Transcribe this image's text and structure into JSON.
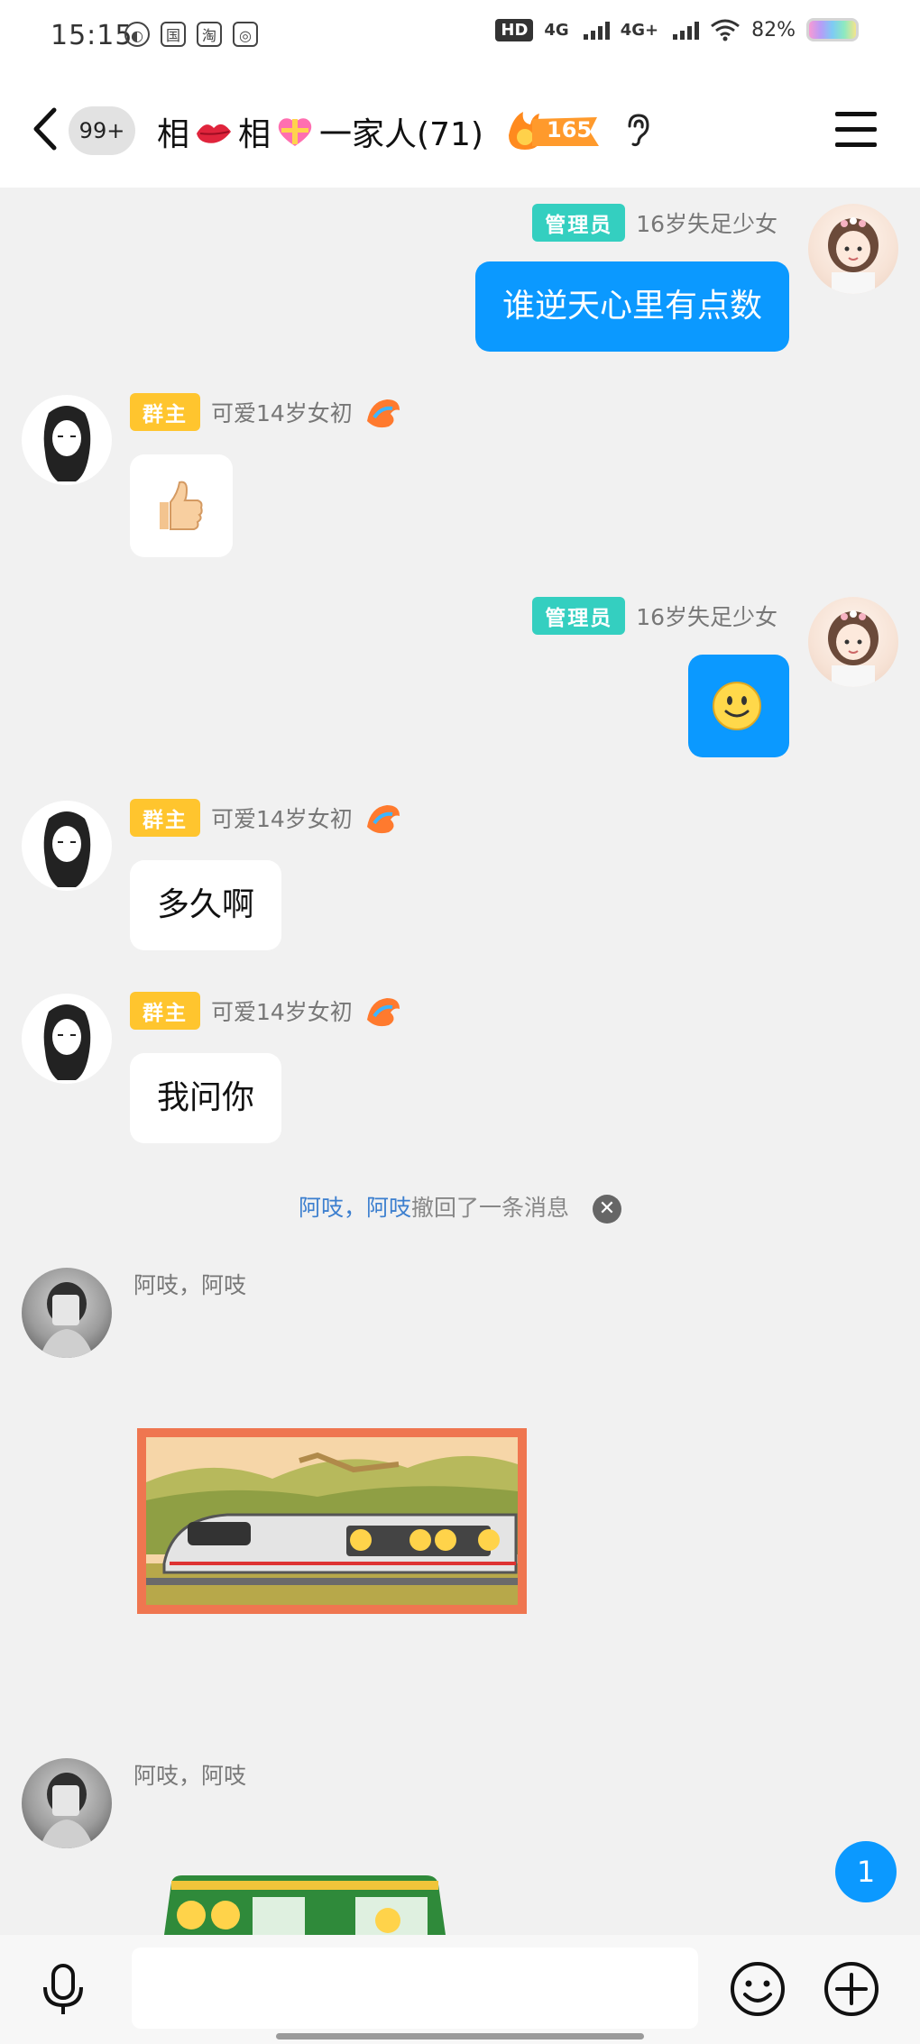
{
  "status_bar": {
    "time": "15:15",
    "app_icons": [
      "weibo-icon",
      "guo-icon",
      "taobao-icon",
      "app-icon"
    ],
    "hd": "HD",
    "net1": "4G",
    "net2": "4G+",
    "battery": "82%"
  },
  "header": {
    "unread_badge": "99+",
    "title_parts": [
      "相",
      "相",
      "一家人(71)"
    ],
    "fire_count": "165"
  },
  "messages": [
    {
      "side": "right",
      "tag": "管理员",
      "name": "16岁失足少女",
      "text": "谁逆天心里有点数"
    },
    {
      "side": "left",
      "tag": "群主",
      "name": "可爱14岁女初",
      "content": "thumbs-up"
    },
    {
      "side": "right",
      "tag": "管理员",
      "name": "16岁失足少女",
      "content": "smile"
    },
    {
      "side": "left",
      "tag": "群主",
      "name": "可爱14岁女初",
      "text": "多久啊"
    },
    {
      "side": "left",
      "tag": "群主",
      "name": "可爱14岁女初",
      "text": "我问你"
    },
    {
      "side": "left",
      "name": "阿吱，阿吱",
      "content": "train-sticker"
    },
    {
      "side": "left",
      "name": "阿吱，阿吱",
      "content": "green-train-sticker"
    }
  ],
  "recall": {
    "user": "阿吱，阿吱",
    "text": "撤回了一条消息"
  },
  "new_message_count": "1",
  "colors": {
    "accent": "#0b99ff",
    "admin": "#34cfc0",
    "owner": "#ffc52e"
  }
}
